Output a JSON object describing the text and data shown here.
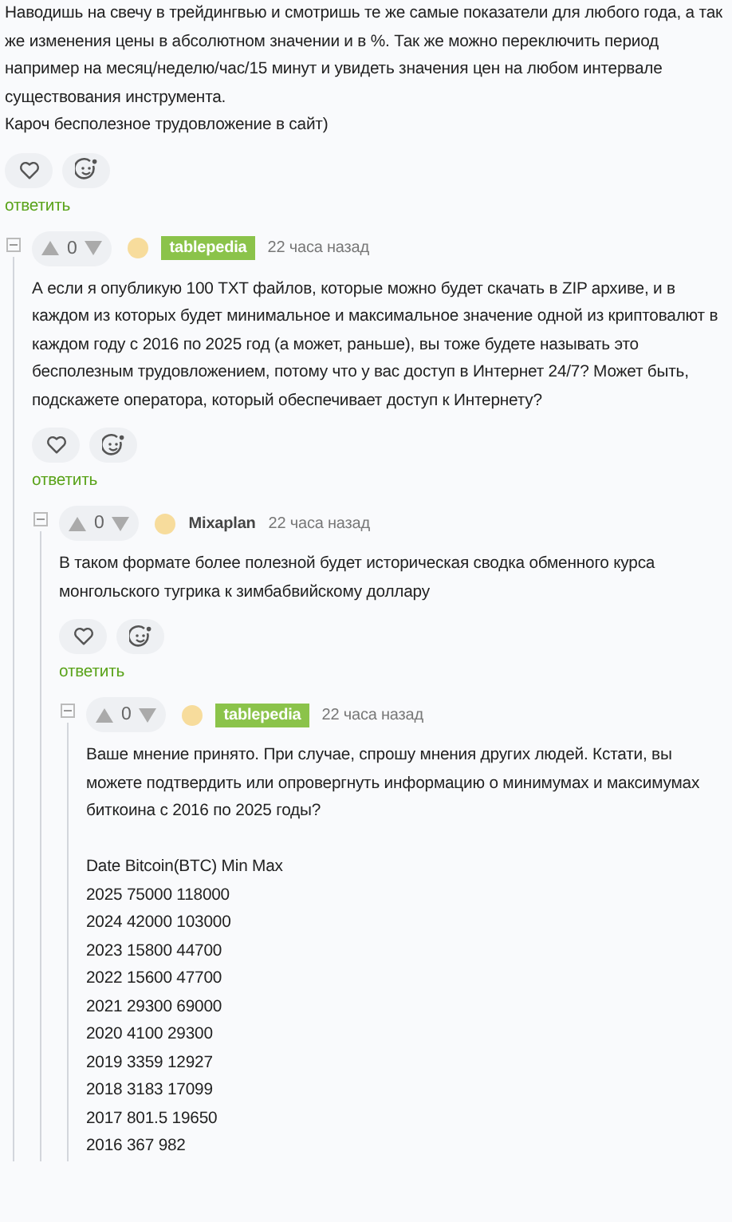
{
  "top_comment": {
    "paragraphs": [
      "Наводишь на свечу в трейдингвью и смотришь те же самые показатели для любого года, а так же изменения цены в абсолютном значении и в %. Так же можно переключить период например на месяц/неделю/час/15 минут и увидеть значения цен на любом интервале существования инструмента.",
      "Кароч бесполезное трудовложение в сайт)"
    ],
    "reply": "ответить"
  },
  "comments": [
    {
      "expanded": true,
      "rating": "0",
      "author": "tablepedia",
      "author_badge": true,
      "time": "22 часа назад",
      "paragraphs": [
        "А если я опубликую 100 TXT файлов, которые можно будет скачать в ZIP архиве, и в каждом из которых будет минимальное и максимальное значение одной из криптовалют в каждом году с 2016 по 2025 год (а может, раньше), вы тоже будете называть это бесполезным трудовложением, потому что у вас доступ в Интернет 24/7? Может быть, подскажете оператора, который обеспечивает доступ к Интернету?"
      ],
      "reply": "ответить",
      "children": [
        {
          "expanded": true,
          "rating": "0",
          "author": "Mixaplan",
          "author_badge": false,
          "time": "22 часа назад",
          "paragraphs": [
            "В таком формате более полезной будет историческая сводка обменного курса монгольского тугрика к зимбабвийскому доллару"
          ],
          "reply": "ответить",
          "children": [
            {
              "expanded": true,
              "rating": "0",
              "author": "tablepedia",
              "author_badge": true,
              "time": "22 часа назад",
              "paragraphs": [
                "Ваше мнение принято. При случае, спрошу мнения других людей. Кстати, вы можете подтвердить или опровергнуть информацию о минимумах и максимумах биткоина с 2016 по 2025 годы?"
              ],
              "lines": [
                "Date Bitcoin(BTC) Min Max",
                "2025 75000 118000",
                "2024 42000 103000",
                "2023 15800 44700",
                "2022 15600 47700",
                "2021 29300 69000",
                "2020 4100 29300",
                "2019 3359 12927",
                "2018 3183 17099",
                "2017 801.5 19650",
                "2016 367 982"
              ]
            }
          ]
        }
      ]
    }
  ]
}
